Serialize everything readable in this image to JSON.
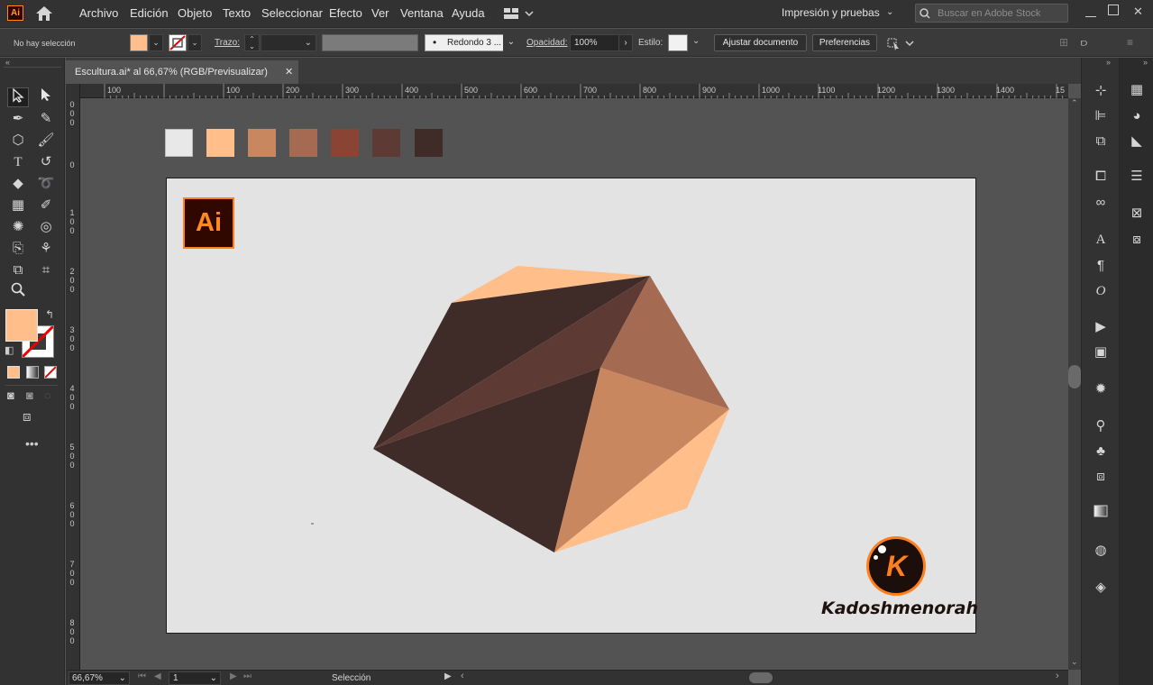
{
  "menu": {
    "app_logo": "Ai",
    "items": [
      "Archivo",
      "Edición",
      "Objeto",
      "Texto",
      "Seleccionar",
      "Efecto",
      "Ver",
      "Ventana",
      "Ayuda"
    ],
    "workspace": "Impresión y pruebas",
    "search_placeholder": "Buscar en Adobe Stock"
  },
  "control": {
    "selection_status": "No hay selección",
    "stroke_label": "Trazo:",
    "brush_value": "Redondo 3 ...",
    "opacity_label": "Opacidad:",
    "opacity_value": "100%",
    "style_label": "Estilo:",
    "document_setup_button": "Ajustar documento",
    "preferences_button": "Preferencias"
  },
  "document": {
    "tab_title": "Escultura.ai* al 66,67% (RGB/Previsualizar)",
    "close_glyph": "✕"
  },
  "rulers": {
    "horizontal": [
      "100",
      "100",
      "200",
      "300",
      "400",
      "500",
      "600",
      "700",
      "800",
      "900",
      "1000",
      "1100",
      "1200",
      "1300",
      "1400",
      "15"
    ],
    "vertical": [
      "0",
      "1",
      "2",
      "3",
      "4",
      "5",
      "6",
      "7",
      "8"
    ]
  },
  "swatches": [
    "#e8e8e8",
    "#ffbe8a",
    "#c8875f",
    "#a46a52",
    "#8b4434",
    "#5e3a35",
    "#3f2b28"
  ],
  "colors": {
    "fill": "#ffbe8a",
    "accent_orange": "#ff7f1e",
    "ai_dark": "#300800"
  },
  "artwork": {
    "badge": "Ai",
    "watermark": "Kadoshmenorah",
    "watermark_logo_letter": "K"
  },
  "status": {
    "zoom": "66,67%",
    "artboard_number": "1",
    "tool": "Selección"
  }
}
